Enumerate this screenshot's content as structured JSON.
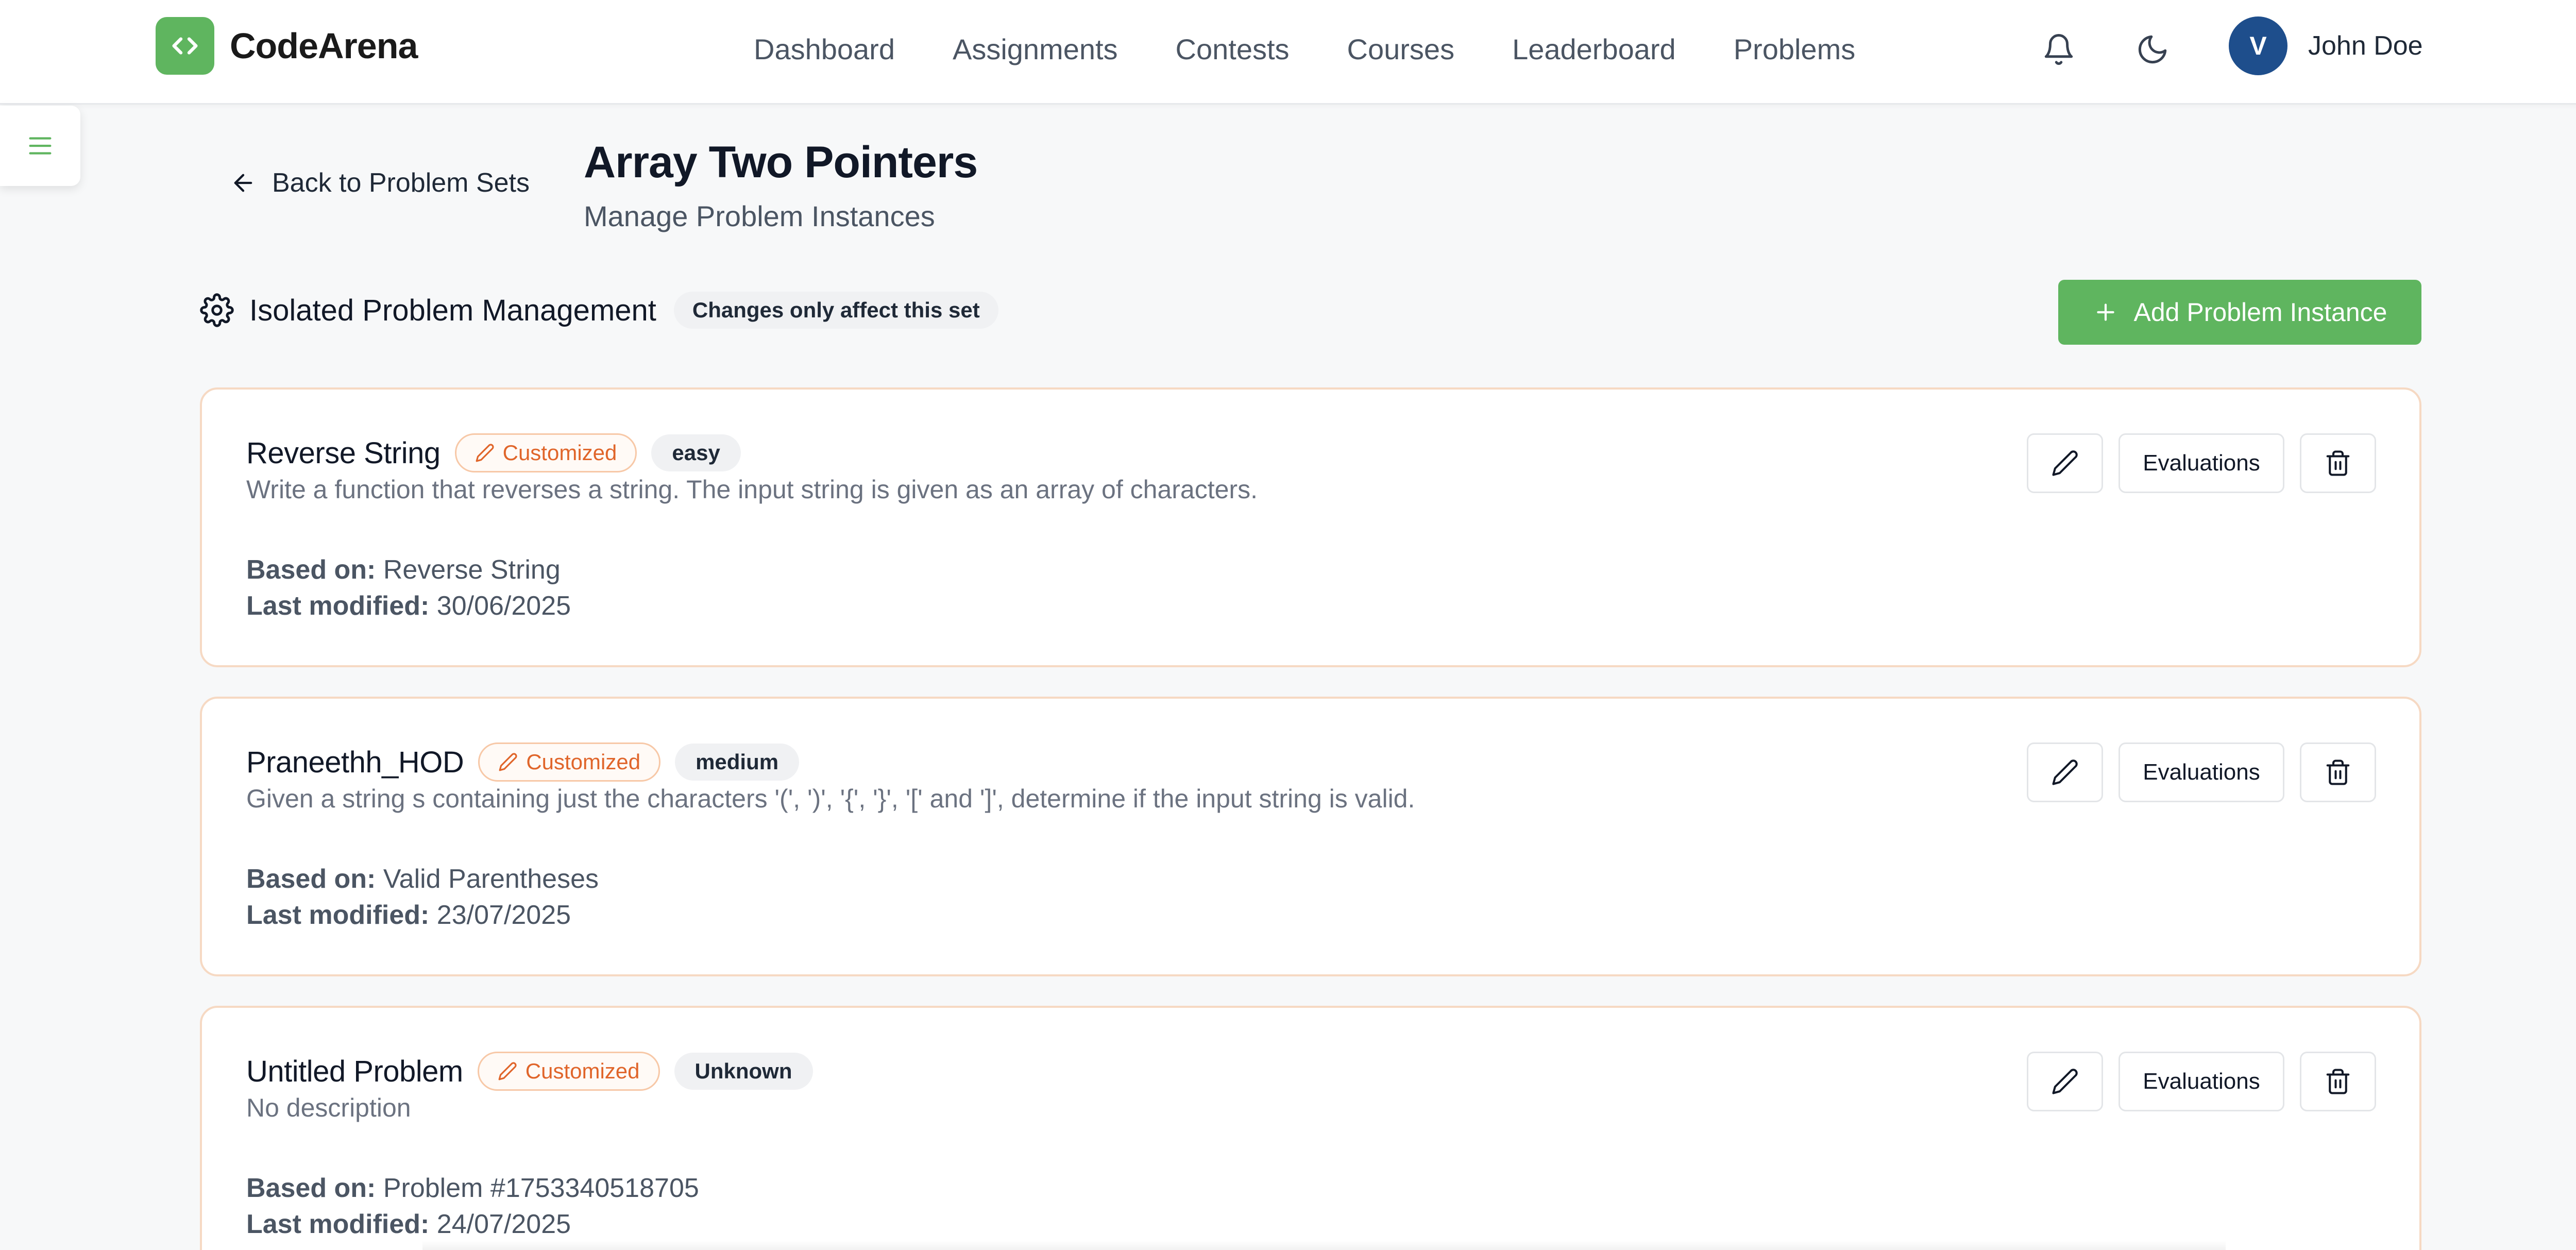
{
  "app": {
    "name": "CodeArena",
    "logo_icon": "code-brackets-icon",
    "brand_color": "#5fb55f"
  },
  "nav": {
    "items": [
      {
        "label": "Dashboard"
      },
      {
        "label": "Assignments"
      },
      {
        "label": "Contests"
      },
      {
        "label": "Courses"
      },
      {
        "label": "Leaderboard"
      },
      {
        "label": "Problems"
      }
    ]
  },
  "header_icons": {
    "notifications": "bell-icon",
    "theme_toggle": "moon-icon"
  },
  "user": {
    "avatar_initial": "V",
    "name": "John Doe",
    "avatar_color": "#1e4e8c"
  },
  "sidebar": {
    "toggle_icon": "menu-icon"
  },
  "page": {
    "back_label": "Back to Problem Sets",
    "title": "Array Two Pointers",
    "subtitle": "Manage Problem Instances"
  },
  "management": {
    "icon": "gear-icon",
    "label": "Isolated Problem Management",
    "badge": "Changes only affect this set",
    "add_button_label": "Add Problem Instance"
  },
  "problems": [
    {
      "title": "Reverse String",
      "custom_tag": "Customized",
      "difficulty": "easy",
      "description": "Write a function that reverses a string. The input string is given as an array of characters.",
      "based_on_label": "Based on:",
      "based_on": "Reverse String",
      "modified_label": "Last modified:",
      "last_modified": "30/06/2025",
      "evaluations_label": "Evaluations"
    },
    {
      "title": "Praneethh_HOD",
      "custom_tag": "Customized",
      "difficulty": "medium",
      "description": "Given a string s containing just the characters '(', ')', '{', '}', '[' and ']', determine if the input string is valid.",
      "based_on_label": "Based on:",
      "based_on": "Valid Parentheses",
      "modified_label": "Last modified:",
      "last_modified": "23/07/2025",
      "evaluations_label": "Evaluations"
    },
    {
      "title": "Untitled Problem",
      "custom_tag": "Customized",
      "difficulty": "Unknown",
      "description": "No description",
      "based_on_label": "Based on:",
      "based_on": "Problem #1753340518705",
      "modified_label": "Last modified:",
      "last_modified": "24/07/2025",
      "evaluations_label": "Evaluations"
    }
  ],
  "colors": {
    "customized_accent": "#e0652a",
    "card_border": "#f6d9c3",
    "primary_button": "#5fb55f"
  }
}
